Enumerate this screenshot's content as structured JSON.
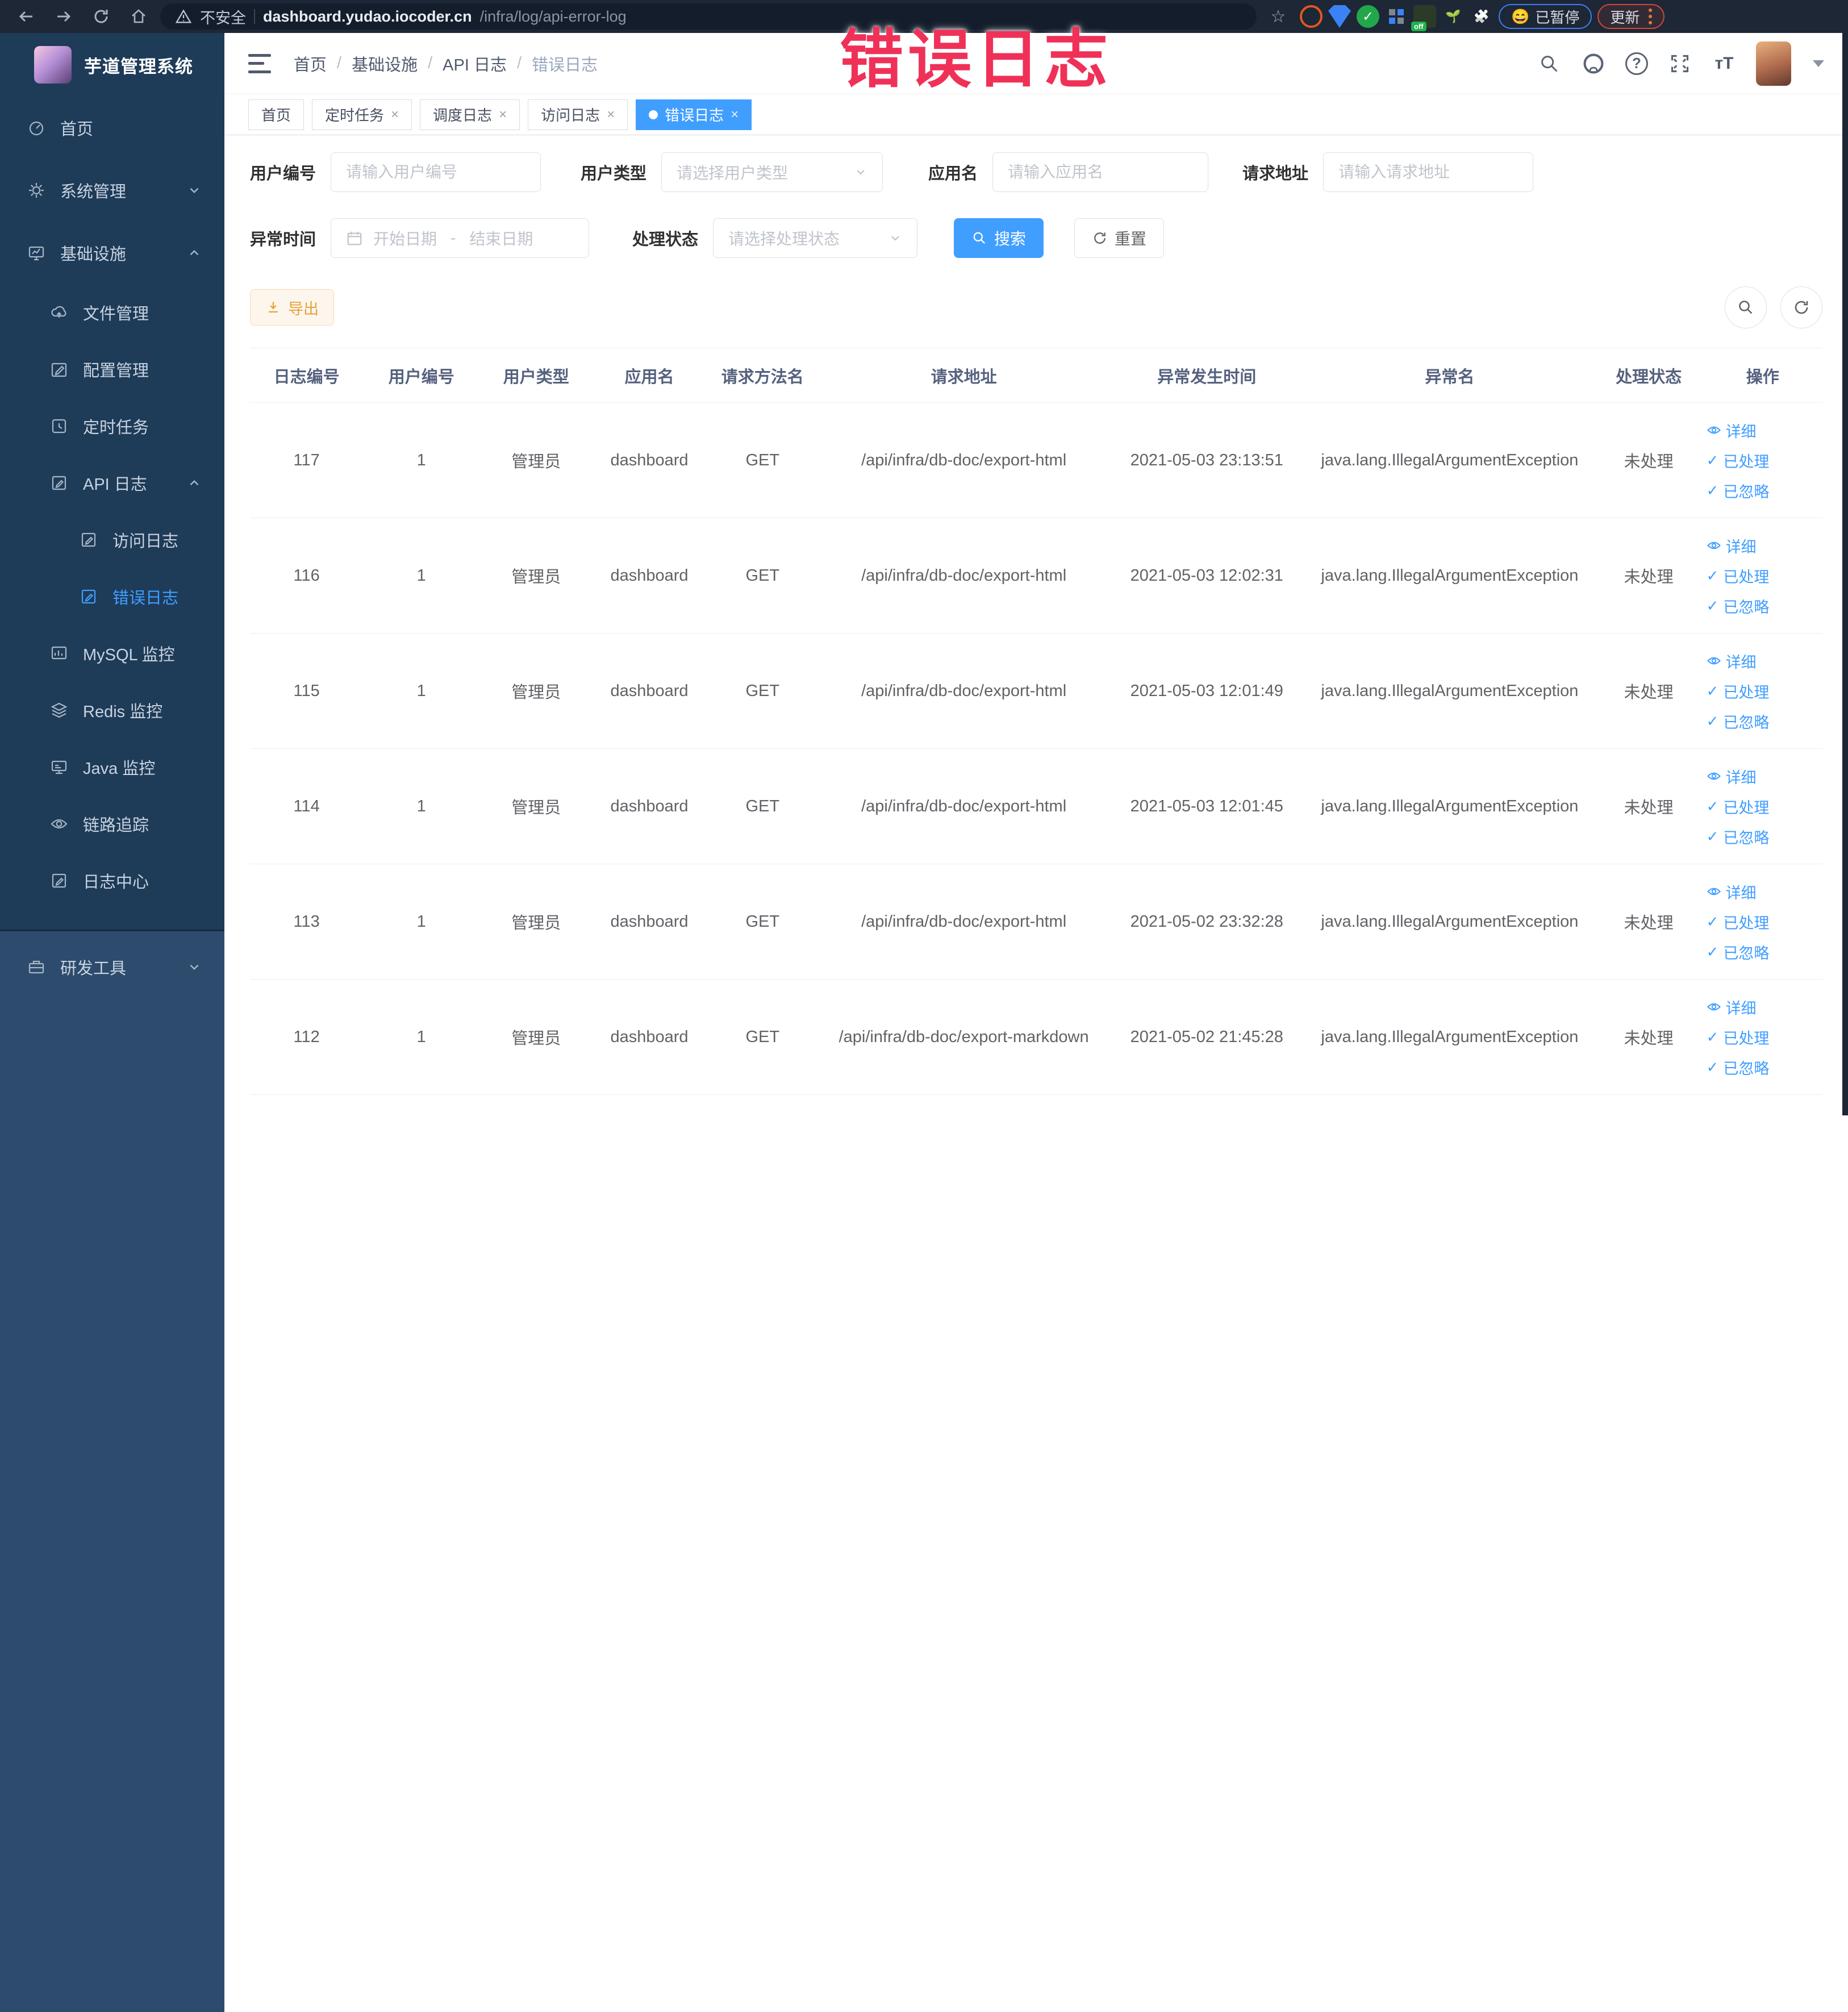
{
  "browser": {
    "security_label": "不安全",
    "url_host": "dashboard.yudao.iocoder.cn",
    "url_path": "/infra/log/api-error-log",
    "paused_label": "已暂停",
    "update_label": "更新"
  },
  "annotation": {
    "text": "错误日志",
    "color": "#ef3158"
  },
  "sidebar": {
    "title": "芋道管理系统",
    "items": [
      {
        "label": "首页"
      },
      {
        "label": "系统管理"
      },
      {
        "label": "基础设施"
      },
      {
        "label": "文件管理"
      },
      {
        "label": "配置管理"
      },
      {
        "label": "定时任务"
      },
      {
        "label": "API 日志"
      },
      {
        "label": "访问日志"
      },
      {
        "label": "错误日志",
        "active": true
      },
      {
        "label": "MySQL 监控"
      },
      {
        "label": "Redis 监控"
      },
      {
        "label": "Java 监控"
      },
      {
        "label": "链路追踪"
      },
      {
        "label": "日志中心"
      },
      {
        "label": "研发工具"
      }
    ]
  },
  "header": {
    "breadcrumb": [
      "首页",
      "基础设施",
      "API 日志",
      "错误日志"
    ],
    "separator": "/"
  },
  "tabs": [
    {
      "label": "首页"
    },
    {
      "label": "定时任务"
    },
    {
      "label": "调度日志"
    },
    {
      "label": "访问日志"
    },
    {
      "label": "错误日志",
      "active": true
    }
  ],
  "filters": {
    "user_id": {
      "label": "用户编号",
      "placeholder": "请输入用户编号"
    },
    "user_type": {
      "label": "用户类型",
      "placeholder": "请选择用户类型"
    },
    "app_name": {
      "label": "应用名",
      "placeholder": "请输入应用名"
    },
    "request_url": {
      "label": "请求地址",
      "placeholder": "请输入请求地址"
    },
    "exception_time": {
      "label": "异常时间",
      "start_placeholder": "开始日期",
      "separator": "-",
      "end_placeholder": "结束日期"
    },
    "process_status": {
      "label": "处理状态",
      "placeholder": "请选择处理状态"
    },
    "search_label": "搜索",
    "reset_label": "重置"
  },
  "toolbar": {
    "export_label": "导出"
  },
  "table": {
    "headers": [
      "日志编号",
      "用户编号",
      "用户类型",
      "应用名",
      "请求方法名",
      "请求地址",
      "异常发生时间",
      "异常名",
      "处理状态",
      "操作"
    ],
    "action_labels": {
      "detail": "详细",
      "processed": "已处理",
      "ignored": "已忽略"
    },
    "rows": [
      {
        "log_id": "117",
        "user_id": "1",
        "user_type": "管理员",
        "app_name": "dashboard",
        "method": "GET",
        "url": "/api/infra/db-doc/export-html",
        "time": "2021-05-03 23:13:51",
        "exception": "java.lang.IllegalArgumentException",
        "status": "未处理"
      },
      {
        "log_id": "116",
        "user_id": "1",
        "user_type": "管理员",
        "app_name": "dashboard",
        "method": "GET",
        "url": "/api/infra/db-doc/export-html",
        "time": "2021-05-03 12:02:31",
        "exception": "java.lang.IllegalArgumentException",
        "status": "未处理"
      },
      {
        "log_id": "115",
        "user_id": "1",
        "user_type": "管理员",
        "app_name": "dashboard",
        "method": "GET",
        "url": "/api/infra/db-doc/export-html",
        "time": "2021-05-03 12:01:49",
        "exception": "java.lang.IllegalArgumentException",
        "status": "未处理"
      },
      {
        "log_id": "114",
        "user_id": "1",
        "user_type": "管理员",
        "app_name": "dashboard",
        "method": "GET",
        "url": "/api/infra/db-doc/export-html",
        "time": "2021-05-03 12:01:45",
        "exception": "java.lang.IllegalArgumentException",
        "status": "未处理"
      },
      {
        "log_id": "113",
        "user_id": "1",
        "user_type": "管理员",
        "app_name": "dashboard",
        "method": "GET",
        "url": "/api/infra/db-doc/export-html",
        "time": "2021-05-02 23:32:28",
        "exception": "java.lang.IllegalArgumentException",
        "status": "未处理"
      },
      {
        "log_id": "112",
        "user_id": "1",
        "user_type": "管理员",
        "app_name": "dashboard",
        "method": "GET",
        "url": "/api/infra/db-doc/export-markdown",
        "time": "2021-05-02 21:45:28",
        "exception": "java.lang.IllegalArgumentException",
        "status": "未处理"
      }
    ]
  },
  "icons": {
    "check_glyph": "✓",
    "close_glyph": "×",
    "help_glyph": "?",
    "font_size_glyph": "тT",
    "star_glyph": "☆",
    "puzzle_glyph": "🧩",
    "emoji_face": "😄",
    "sprout_glyph": "🌱"
  },
  "colors": {
    "primary": "#409eff",
    "warning": "#e6a23c",
    "annotation_red": "#ef3158",
    "chrome_bg": "#1d2736",
    "sidebar_bg": "#1e3b58",
    "sidebar_lower_bg": "#2d4b6d"
  }
}
